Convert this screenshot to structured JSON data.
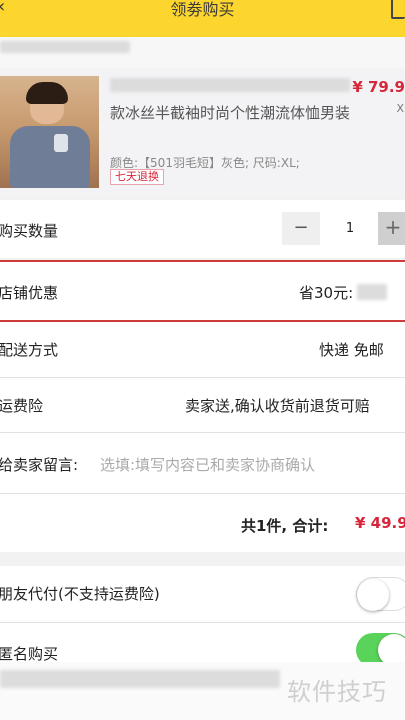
{
  "header": {
    "title": "领劵购买"
  },
  "product": {
    "title": "款冰丝半截袖时尚个性潮流体恤男装",
    "spec": "颜色:【501羽毛短】灰色; 尺码:XL;",
    "badge": "七天退换",
    "price": "¥ 79.9",
    "qty_mark": "X"
  },
  "quantity": {
    "label": "购买数量",
    "value": "1",
    "minus": "−",
    "plus": "+"
  },
  "store_discount": {
    "label": "店铺优惠",
    "value": "省30元:"
  },
  "shipping": {
    "label": "配送方式",
    "value": "快递 免邮"
  },
  "shipping_insurance": {
    "label": "运费险",
    "value": "卖家送,确认收货前退货可赔"
  },
  "message": {
    "label": "给卖家留言:",
    "placeholder": "选填:填写内容已和卖家协商确认"
  },
  "summary": {
    "count_text": "共1件, 合计:",
    "total": "¥ 49.9"
  },
  "friend_pay": {
    "label": "朋友代付(不支持运费险)",
    "enabled": false
  },
  "anonymous": {
    "label": "匿名购买",
    "enabled": true
  },
  "watermark": "软件技巧",
  "colors": {
    "header": "#fcd52e",
    "accent_red": "#d6263a",
    "toggle_on": "#5ad35a"
  }
}
